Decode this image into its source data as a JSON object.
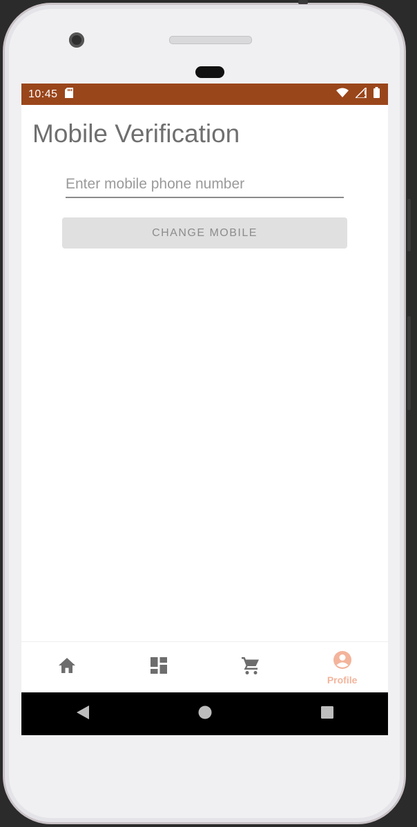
{
  "status_bar": {
    "time": "10:45",
    "background": "#9a461b",
    "icons": [
      "sd-card-icon",
      "wifi-icon",
      "signal-icon",
      "battery-icon"
    ]
  },
  "main": {
    "title": "Mobile Verification",
    "phone_input": {
      "placeholder": "Enter mobile phone number",
      "value": ""
    },
    "change_button_label": "CHANGE MOBILE"
  },
  "bottom_nav": {
    "items": [
      {
        "icon": "home-icon",
        "label": ""
      },
      {
        "icon": "dashboard-icon",
        "label": ""
      },
      {
        "icon": "cart-icon",
        "label": ""
      },
      {
        "icon": "account-circle-icon",
        "label": "Profile",
        "active": true
      }
    ],
    "active_color": "#f3b49b",
    "inactive_color": "#6d6d6d"
  },
  "system_nav": {
    "buttons": [
      "back-icon",
      "home-circle-icon",
      "recents-icon"
    ]
  }
}
